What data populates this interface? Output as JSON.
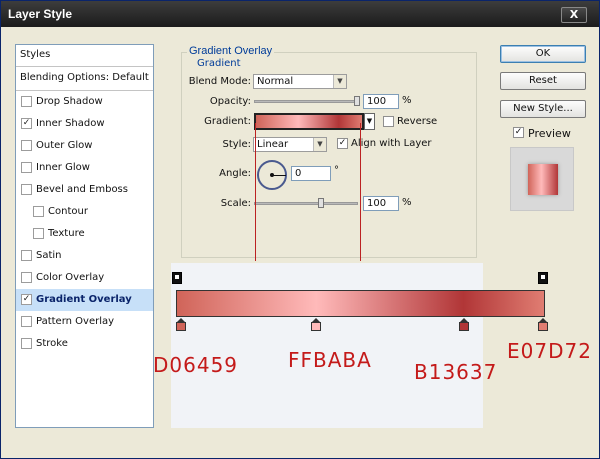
{
  "window": {
    "title": "Layer Style",
    "close_label": "X"
  },
  "styles_panel": {
    "header": "Styles",
    "blending": "Blending Options: Default",
    "items": [
      {
        "label": "Drop Shadow",
        "checked": false,
        "sub": false
      },
      {
        "label": "Inner Shadow",
        "checked": true,
        "sub": false
      },
      {
        "label": "Outer Glow",
        "checked": false,
        "sub": false
      },
      {
        "label": "Inner Glow",
        "checked": false,
        "sub": false
      },
      {
        "label": "Bevel and Emboss",
        "checked": false,
        "sub": false
      },
      {
        "label": "Contour",
        "checked": false,
        "sub": true
      },
      {
        "label": "Texture",
        "checked": false,
        "sub": true
      },
      {
        "label": "Satin",
        "checked": false,
        "sub": false
      },
      {
        "label": "Color Overlay",
        "checked": false,
        "sub": false
      },
      {
        "label": "Gradient Overlay",
        "checked": true,
        "sub": false,
        "selected": true
      },
      {
        "label": "Pattern Overlay",
        "checked": false,
        "sub": false
      },
      {
        "label": "Stroke",
        "checked": false,
        "sub": false
      }
    ]
  },
  "gradient_overlay": {
    "title": "Gradient Overlay",
    "subtitle": "Gradient",
    "blend_mode_label": "Blend Mode:",
    "blend_mode": "Normal",
    "opacity_label": "Opacity:",
    "opacity": "100",
    "opacity_value": 100,
    "percent": "%",
    "gradient_label": "Gradient:",
    "reverse_label": "Reverse",
    "style_label": "Style:",
    "style": "Linear",
    "align_label": "Align with Layer",
    "angle_label": "Angle:",
    "angle": "0",
    "degree": "°",
    "scale_label": "Scale:",
    "scale": "100",
    "scale_value": 100
  },
  "gradient_stops": [
    {
      "label": "D06459",
      "color": "#d06459",
      "position": 0
    },
    {
      "label": "FFBABA",
      "color": "#ffbaba",
      "position": 38
    },
    {
      "label": "B13637",
      "color": "#b13637",
      "position": 78
    },
    {
      "label": "E07D72",
      "color": "#e07d72",
      "position": 100
    }
  ],
  "buttons": {
    "ok": "OK",
    "reset": "Reset",
    "new_style": "New Style...",
    "preview": "Preview"
  },
  "colors": {
    "title_bar": "#2a2a2a",
    "accent": "#003c99",
    "annotation": "#c41a1a"
  }
}
